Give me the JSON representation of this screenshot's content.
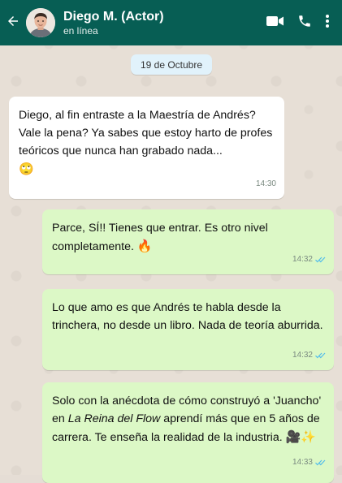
{
  "header": {
    "contact_name": "Diego M. (Actor)",
    "status": "en línea",
    "bg_color": "#075e54",
    "icons": [
      "back-arrow-icon",
      "video-call-icon",
      "phone-icon",
      "more-vert-icon"
    ]
  },
  "chat": {
    "date_chip": "19 de Octubre",
    "messages": [
      {
        "direction": "incoming",
        "text": "Diego, al fin entraste a la Maestría de Andrés? Vale la pena? Ya sabes que estoy harto de profes teóricos que nunca han grabado nada...",
        "emoji": "🙄",
        "time": "14:30"
      },
      {
        "direction": "outgoing",
        "text": "Parce, SÍ!! Tienes que entrar. Es otro nivel completamente.",
        "emoji": "🔥",
        "time": "14:32",
        "status": "read"
      },
      {
        "direction": "outgoing",
        "text": "Lo que amo es que Andrés te habla desde la trinchera, no desde un libro. Nada de teoría aburrida.",
        "time": "14:32",
        "status": "read"
      },
      {
        "direction": "outgoing",
        "text_before": "Solo con la anécdota de cómo construyó a 'Juancho' en ",
        "text_italic": "La Reina del Flow",
        "text_after": " aprendí más que en 5 años de carrera. Te enseña la realidad de la industria.",
        "emoji": "🎥✨",
        "time": "14:33",
        "status": "read"
      }
    ]
  },
  "colors": {
    "incoming_bubble": "#ffffff",
    "outgoing_bubble": "#dcf8c6",
    "read_ticks": "#53bdeb",
    "date_chip": "#e1f2fb"
  }
}
